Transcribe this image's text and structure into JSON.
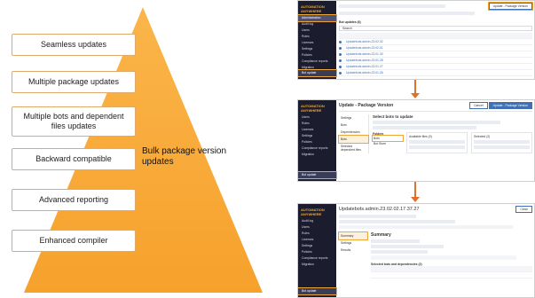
{
  "features": [
    "Seamless updates",
    "Multiple package updates",
    "Multiple bots and dependent files updates",
    "Backward compatible",
    "Advanced reporting",
    "Enhanced compiler"
  ],
  "center_label": "Bulk package version updates",
  "colors": {
    "triangle_top": "#fbb54a",
    "triangle_bottom": "#f6a12c",
    "box_border": "#e0a96e",
    "arrow": "#e0702a",
    "sidebar": "#1b1d2e",
    "accent_blue": "#3f6fb5"
  },
  "screen1": {
    "logo": "AUTOMATION ANYWHERE",
    "nav": [
      "Administration",
      "Audit log",
      "Users",
      "Roles",
      "Licenses",
      "Settings",
      "Policies",
      "Compliance reports",
      "Migration"
    ],
    "bottom_nav": "Bot update",
    "section_title": "Bot updates (6)",
    "search_placeholder": "Search",
    "rows": [
      "Updatebots.admin.23.02.02",
      "Updatebots.admin.23.02.01",
      "Updatebots.admin.23.01.30",
      "Updatebots.admin.23.01.28",
      "Updatebots.admin.23.01.27",
      "Updatebots.admin.23.01.26"
    ],
    "button": "Update - Package Version"
  },
  "screen2": {
    "logo": "AUTOMATION ANYWHERE",
    "title": "Update - Package Version",
    "cancel": "Cancel",
    "primary": "Update - Package Version",
    "steps": [
      "Settings",
      "Bots",
      "Dependencies",
      "Bots",
      "Selected dependent files"
    ],
    "panel_title": "Select bots to update",
    "folders_label": "Folders",
    "folders": [
      "Bots",
      "Bot Store"
    ],
    "available": "Available files (0)",
    "selected": "Selected (2)",
    "nav": [
      "Users",
      "Roles",
      "Licenses",
      "Settings",
      "Policies",
      "Compliance reports",
      "Migration"
    ],
    "bottom_nav": "Bot update"
  },
  "screen3": {
    "logo": "AUTOMATION ANYWHERE",
    "title": "Updatebots.admin.23.02.02.17.37.27",
    "close": "Close",
    "tabs": [
      "Summary",
      "Settings",
      "Results"
    ],
    "summary_title": "Summary",
    "list_title": "Selected bots and dependencies (2)",
    "nav": [
      "Audit log",
      "Users",
      "Roles",
      "Licenses",
      "Settings",
      "Policies",
      "Compliance reports",
      "Migration"
    ],
    "bottom_nav": "Bot update"
  }
}
